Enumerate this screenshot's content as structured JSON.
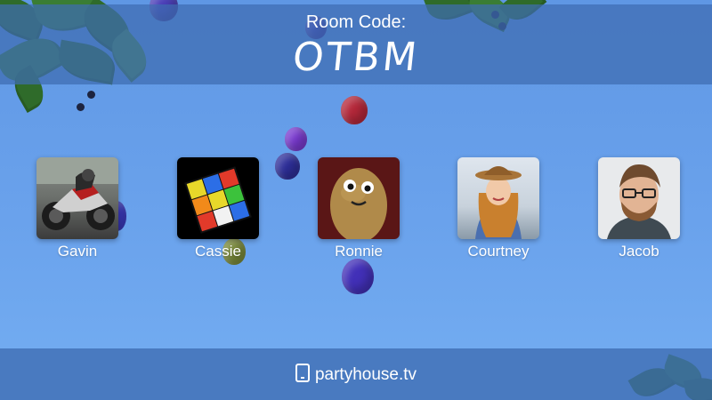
{
  "header": {
    "room_label": "Room Code:",
    "room_code": "OTBM"
  },
  "players": [
    {
      "name": "Gavin",
      "avatar": "motorcycle-rider-avatar"
    },
    {
      "name": "Cassie",
      "avatar": "rubiks-cube-avatar"
    },
    {
      "name": "Ronnie",
      "avatar": "potato-avatar"
    },
    {
      "name": "Courtney",
      "avatar": "woman-in-hat-avatar"
    },
    {
      "name": "Jacob",
      "avatar": "man-with-glasses-avatar"
    }
  ],
  "footer": {
    "site": "partyhouse.tv",
    "icon": "tablet-icon"
  },
  "colors": {
    "sky": "#6aa2ec",
    "banner": "#3e6cb2",
    "text": "#ffffff"
  }
}
